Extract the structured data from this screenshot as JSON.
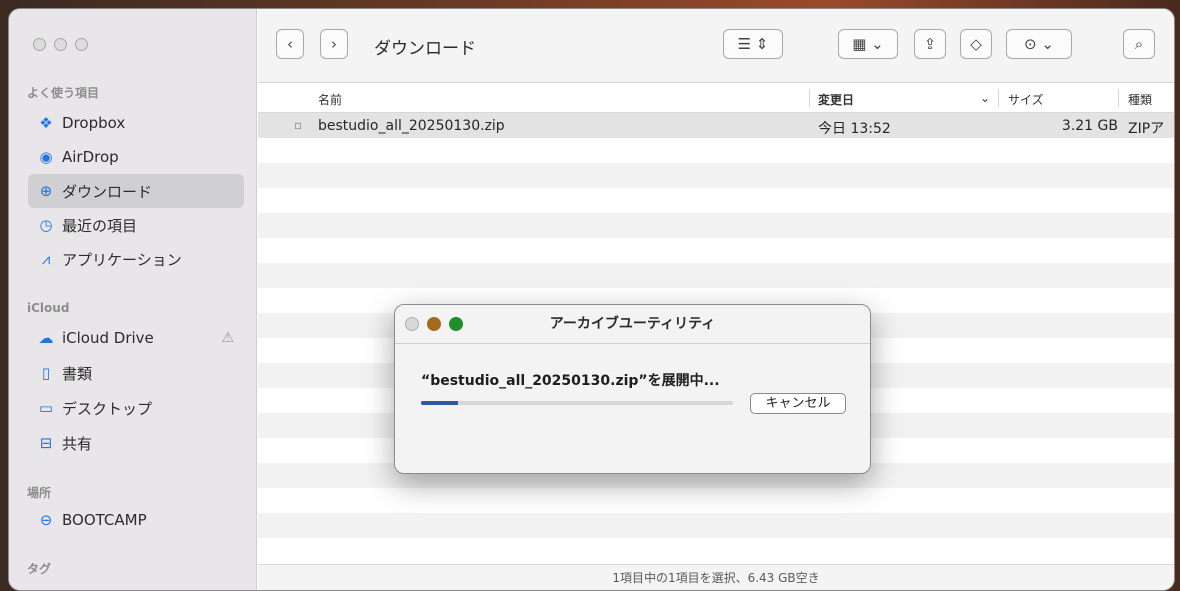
{
  "finder": {
    "window_title": "ダウンロード",
    "sidebar": {
      "sections": {
        "favorites": "よく使う項目",
        "icloud": "iCloud",
        "locations": "場所",
        "tags": "タグ"
      },
      "items": [
        {
          "label": "Dropbox",
          "icon": "dropbox-icon"
        },
        {
          "label": "AirDrop",
          "icon": "airdrop-icon"
        },
        {
          "label": "ダウンロード",
          "icon": "download-icon"
        },
        {
          "label": "最近の項目",
          "icon": "clock-icon"
        },
        {
          "label": "アプリケーション",
          "icon": "applications-icon"
        },
        {
          "label": "iCloud Drive",
          "icon": "cloud-icon"
        },
        {
          "label": "書類",
          "icon": "document-icon"
        },
        {
          "label": "デスクトップ",
          "icon": "desktop-icon"
        },
        {
          "label": "共有",
          "icon": "shared-folder-icon"
        },
        {
          "label": "BOOTCAMP",
          "icon": "drive-icon"
        }
      ]
    },
    "columns": {
      "name": "名前",
      "modified": "変更日",
      "size": "サイズ",
      "kind": "種類"
    },
    "files": [
      {
        "name": "bestudio_all_20250130.zip",
        "modified": "今日 13:52",
        "size": "3.21 GB",
        "kind": "ZIPアー"
      }
    ],
    "status": "1項目中の1項目を選択、6.43 GB空き"
  },
  "dialog": {
    "title": "アーカイブユーティリティ",
    "message": "“bestudio_all_20250130.zip”を展開中...",
    "cancel_label": "キャンセル",
    "progress": 0.12,
    "colors": {
      "close": "#d7d7d7",
      "minimize": "#a56b1c",
      "zoom": "#1f8f2b",
      "progress_fill": "#2c5aa8"
    }
  }
}
